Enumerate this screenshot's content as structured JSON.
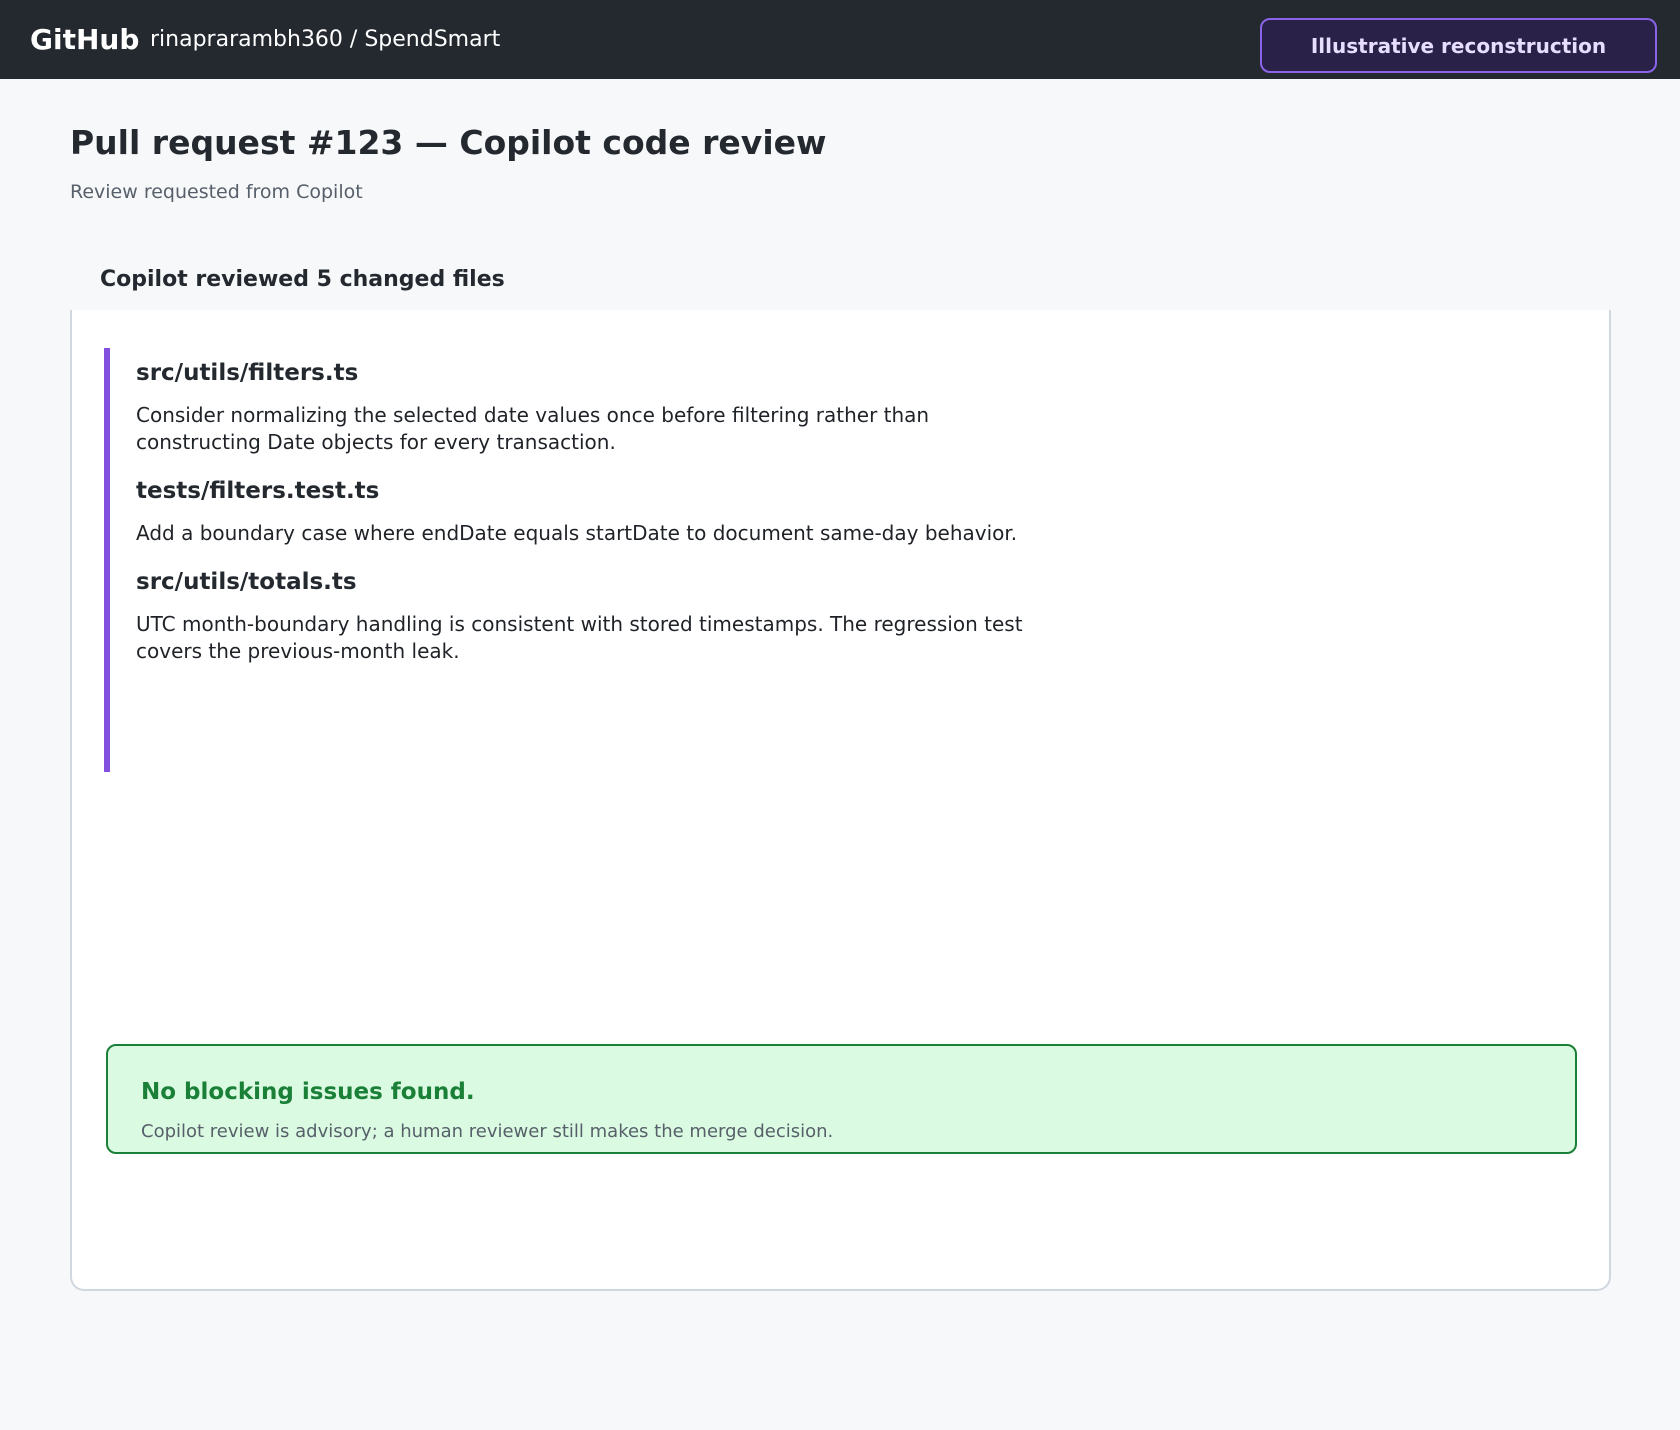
{
  "header": {
    "brand": "GitHub",
    "repo_path": "rinaprarambh360 / SpendSmart",
    "badge": "Illustrative reconstruction"
  },
  "page": {
    "title": "Pull request #123 — Copilot code review",
    "subtitle": "Review requested from Copilot"
  },
  "review": {
    "heading": "Copilot reviewed 5 changed files",
    "comments": [
      {
        "file": "src/utils/filters.ts",
        "body": "Consider normalizing the selected date values once before filtering rather than constructing Date objects for every transaction."
      },
      {
        "file": "tests/filters.test.ts",
        "body": "Add a boundary case where endDate equals startDate to document same-day behavior."
      },
      {
        "file": "src/utils/totals.ts",
        "body": "UTC month-boundary handling is consistent with stored timestamps. The regression test covers the previous-month leak."
      }
    ],
    "status": {
      "title": "No blocking issues found.",
      "note": "Copilot review is advisory; a human reviewer still makes the merge decision."
    }
  },
  "colors": {
    "topbar": "#24292f",
    "accent": "#8250df",
    "success": "#1a7f37",
    "success_bg": "#dafbe1"
  }
}
